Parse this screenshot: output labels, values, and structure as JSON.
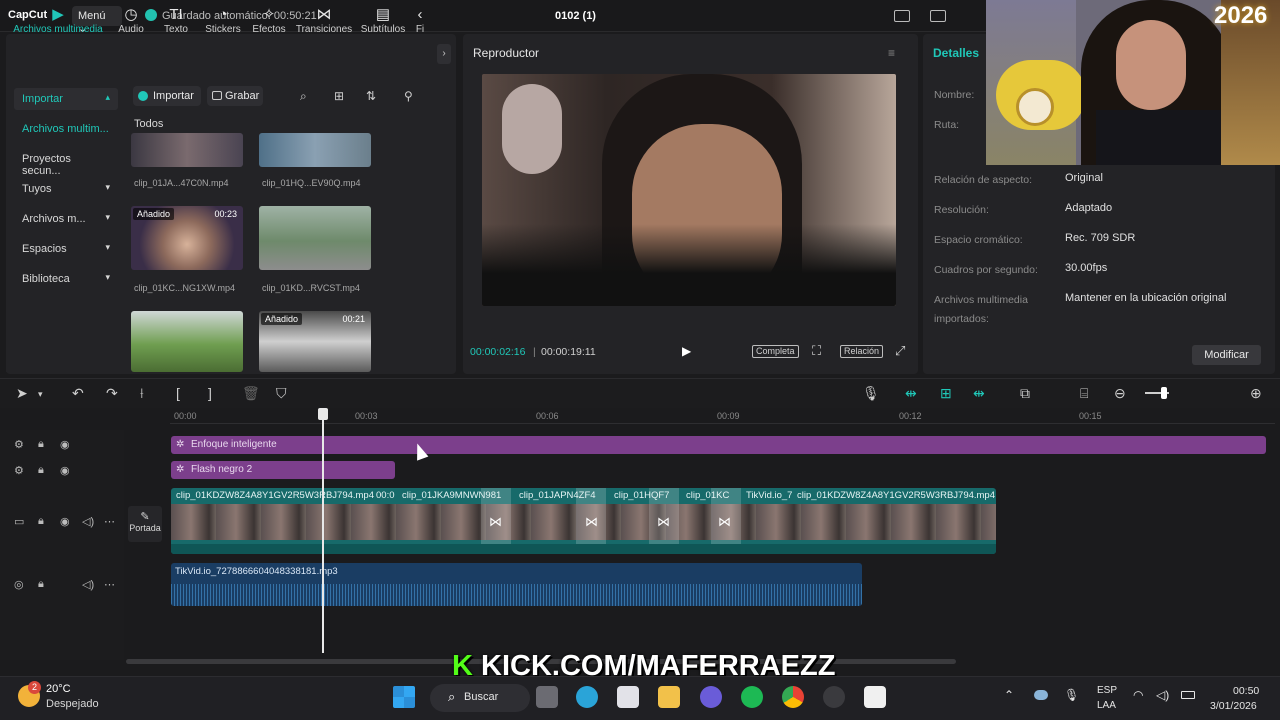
{
  "app": {
    "logo": "CapCut",
    "menu_label": "Menú ⌄",
    "autosave": "Guardado automático: 00:50:21",
    "project_name": "0102 (1)"
  },
  "toolbar": {
    "tabs": [
      {
        "label": "Archivos multimedia",
        "icon": "media-icon"
      },
      {
        "label": "Audio",
        "icon": "audio-icon"
      },
      {
        "label": "Texto",
        "icon": "text-icon"
      },
      {
        "label": "Stickers",
        "icon": "sticker-icon"
      },
      {
        "label": "Efectos",
        "icon": "effects-icon"
      },
      {
        "label": "Transiciones",
        "icon": "transitions-icon"
      },
      {
        "label": "Subtítulos",
        "icon": "subtitles-icon"
      },
      {
        "label": "Fi",
        "icon": "filters-icon"
      }
    ]
  },
  "sidebar": {
    "items": [
      {
        "label": "Importar",
        "caret": "▴"
      },
      {
        "label": "Archivos multim...",
        "caret": ""
      },
      {
        "label": "Proyectos secun...",
        "caret": ""
      },
      {
        "label": "Tuyos",
        "caret": "▾"
      },
      {
        "label": "Archivos m...",
        "caret": "▾"
      },
      {
        "label": "Espacios",
        "caret": "▾"
      },
      {
        "label": "Biblioteca",
        "caret": "▾"
      }
    ]
  },
  "media": {
    "import_label": "Importar",
    "record_label": "Grabar",
    "section_label": "Todos",
    "clips": [
      {
        "name": "clip_01JA...47C0N.mp4",
        "badge": "",
        "duration": ""
      },
      {
        "name": "clip_01HQ...EV90Q.mp4",
        "badge": "",
        "duration": ""
      },
      {
        "name": "clip_01KC...NG1XW.mp4",
        "badge": "Añadido",
        "duration": "00:23"
      },
      {
        "name": "clip_01KD...RVCST.mp4",
        "badge": "",
        "duration": ""
      },
      {
        "name": "",
        "badge": "",
        "duration": ""
      },
      {
        "name": "",
        "badge": "Añadido",
        "duration": "00:21"
      }
    ]
  },
  "player": {
    "title": "Reproductor",
    "current_time": "00:00:02:16",
    "total_time": "00:00:19:11",
    "full_label": "Completa",
    "ratio_label": "Relación"
  },
  "details": {
    "title": "Detalles",
    "rows": [
      {
        "key": "Nombre:",
        "value": ""
      },
      {
        "key": "Ruta:",
        "value": ""
      },
      {
        "key": "Relación de aspecto:",
        "value": "Original"
      },
      {
        "key": "Resolución:",
        "value": "Adaptado"
      },
      {
        "key": "Espacio cromático:",
        "value": "Rec. 709 SDR"
      },
      {
        "key": "Cuadros por segundo:",
        "value": "30.00fps"
      },
      {
        "key": "Archivos multimedia",
        "value": "Mantener en la ubicación original"
      },
      {
        "key": "importados:",
        "value": ""
      }
    ],
    "modify_label": "Modificar"
  },
  "overlay": {
    "year": "2026",
    "kick_k": "K",
    "kick_text": "KICK.COM/MAFERRAEZZ"
  },
  "timeline": {
    "ticks": [
      "00:00",
      "00:03",
      "00:06",
      "00:09",
      "00:12",
      "00:15"
    ],
    "effects": [
      {
        "label": "Enfoque inteligente"
      },
      {
        "label": "Flash negro 2"
      }
    ],
    "video_segments": [
      "clip_01KDZW8Z4A8Y1GV2R5W3RBJ794.mp4",
      "00:0",
      "clip_01JKA9MNWN981",
      "clip_01JAPN4ZF4",
      "clip_01HQF7",
      "clip_01KC",
      "TikVid.io_7",
      "clip_01KDZW8Z4A8Y1GV2R5W3RBJ794.mp4"
    ],
    "audio_clip": "TikVid.io_7278866604048338181.mp3",
    "cover_label": "Portada"
  },
  "taskbar": {
    "weather_temp": "20°C",
    "weather_desc": "Despejado",
    "weather_badge": "2",
    "search_label": "Buscar",
    "lang_1": "ESP",
    "lang_2": "LAA",
    "time": "00:50",
    "date": "3/01/2026"
  },
  "colors": {
    "accent": "#20c7b8",
    "effect_clip": "#7c3f8c",
    "video_clip": "#176a6a",
    "audio_clip": "#1a3d63"
  }
}
